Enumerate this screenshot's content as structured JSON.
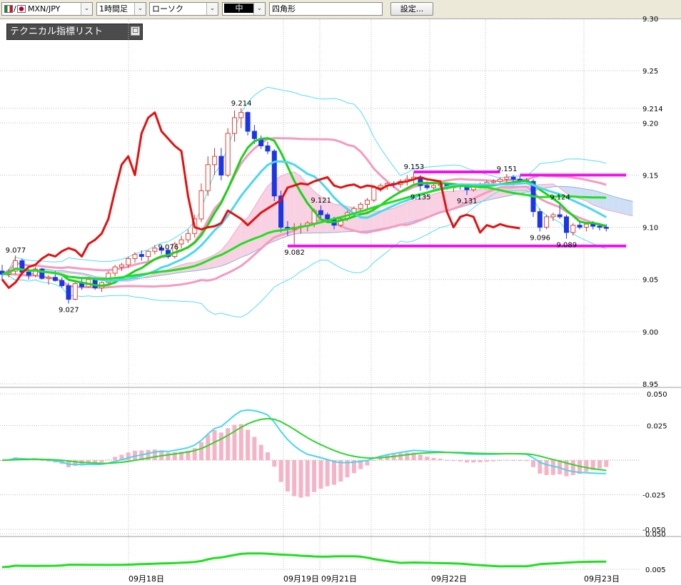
{
  "toolbar": {
    "pair": "MXN/JPY",
    "timeframe": "1時間足",
    "chart_style": "ローソク",
    "line_label": "中",
    "drawing_tool": "四角形",
    "settings_button": "設定..."
  },
  "indicator_panel": {
    "title": "テクニカル指標リスト",
    "button": "□"
  },
  "chart_data": [
    {
      "type": "candlestick",
      "ylim": [
        8.95,
        9.3
      ],
      "yticks": [
        "9.30",
        "9.25",
        "9.214",
        "9.20",
        "9.15",
        "9.10",
        "9.05",
        "9.00",
        "8.95"
      ],
      "xticks": [
        "09月18日",
        "09月19日",
        "09月21日",
        "09月22日",
        "09月23日"
      ],
      "candles": [
        [
          9.058,
          9.064,
          9.05,
          9.055
        ],
        [
          9.055,
          9.06,
          9.052,
          9.058
        ],
        [
          9.058,
          9.073,
          9.055,
          9.068
        ],
        [
          9.068,
          9.07,
          9.056,
          9.057
        ],
        [
          9.057,
          9.06,
          9.05,
          9.054
        ],
        [
          9.054,
          9.062,
          9.052,
          9.06
        ],
        [
          9.06,
          9.061,
          9.05,
          9.051
        ],
        [
          9.051,
          9.054,
          9.045,
          9.052
        ],
        [
          9.052,
          9.058,
          9.048,
          9.049
        ],
        [
          9.049,
          9.052,
          9.042,
          9.044
        ],
        [
          9.044,
          9.047,
          9.027,
          9.031
        ],
        [
          9.031,
          9.048,
          9.03,
          9.046
        ],
        [
          9.046,
          9.052,
          9.04,
          9.043
        ],
        [
          9.043,
          9.051,
          9.042,
          9.05
        ],
        [
          9.05,
          9.052,
          9.04,
          9.042
        ],
        [
          9.042,
          9.048,
          9.038,
          9.047
        ],
        [
          9.047,
          9.058,
          9.045,
          9.056
        ],
        [
          9.056,
          9.064,
          9.053,
          9.062
        ],
        [
          9.062,
          9.066,
          9.058,
          9.064
        ],
        [
          9.064,
          9.072,
          9.061,
          9.07
        ],
        [
          9.07,
          9.076,
          9.066,
          9.074
        ],
        [
          9.074,
          9.078,
          9.068,
          9.072
        ],
        [
          9.072,
          9.078,
          9.068,
          9.077
        ],
        [
          9.077,
          9.083,
          9.074,
          9.08
        ],
        [
          9.08,
          9.082,
          9.074,
          9.078
        ],
        [
          9.078,
          9.08,
          9.07,
          9.072
        ],
        [
          9.072,
          9.086,
          9.07,
          9.084
        ],
        [
          9.084,
          9.092,
          9.08,
          9.088
        ],
        [
          9.088,
          9.098,
          9.085,
          9.094
        ],
        [
          9.094,
          9.112,
          9.09,
          9.108
        ],
        [
          9.108,
          9.142,
          9.105,
          9.135
        ],
        [
          9.135,
          9.168,
          9.13,
          9.16
        ],
        [
          9.16,
          9.176,
          9.15,
          9.168
        ],
        [
          9.168,
          9.176,
          9.145,
          9.15
        ],
        [
          9.15,
          9.195,
          9.148,
          9.19
        ],
        [
          9.19,
          9.212,
          9.182,
          9.205
        ],
        [
          9.205,
          9.214,
          9.195,
          9.21
        ],
        [
          9.21,
          9.211,
          9.188,
          9.192
        ],
        [
          9.192,
          9.198,
          9.18,
          9.185
        ],
        [
          9.185,
          9.188,
          9.175,
          9.178
        ],
        [
          9.178,
          9.182,
          9.17,
          9.173
        ],
        [
          9.173,
          9.175,
          9.125,
          9.13
        ],
        [
          9.13,
          9.135,
          9.095,
          9.1
        ],
        [
          9.1,
          9.106,
          9.092,
          9.098
        ],
        [
          9.098,
          9.104,
          9.082,
          9.1
        ],
        [
          9.1,
          9.104,
          9.094,
          9.101
        ],
        [
          9.101,
          9.106,
          9.096,
          9.104
        ],
        [
          9.104,
          9.118,
          9.1,
          9.116
        ],
        [
          9.116,
          9.121,
          9.108,
          9.112
        ],
        [
          9.112,
          9.114,
          9.104,
          9.108
        ],
        [
          9.108,
          9.11,
          9.098,
          9.102
        ],
        [
          9.102,
          9.11,
          9.1,
          9.108
        ],
        [
          9.108,
          9.116,
          9.106,
          9.114
        ],
        [
          9.114,
          9.12,
          9.11,
          9.118
        ],
        [
          9.118,
          9.124,
          9.114,
          9.122
        ],
        [
          9.122,
          9.128,
          9.118,
          9.126
        ],
        [
          9.126,
          9.14,
          9.124,
          9.138
        ],
        [
          9.138,
          9.142,
          9.134,
          9.14
        ],
        [
          9.14,
          9.143,
          9.136,
          9.142
        ],
        [
          9.142,
          9.144,
          9.138,
          9.141
        ],
        [
          9.141,
          9.146,
          9.138,
          9.144
        ],
        [
          9.144,
          9.15,
          9.14,
          9.146
        ],
        [
          9.146,
          9.153,
          9.142,
          9.148
        ],
        [
          9.148,
          9.15,
          9.135,
          9.14
        ],
        [
          9.14,
          9.144,
          9.136,
          9.138
        ],
        [
          9.138,
          9.142,
          9.135,
          9.14
        ],
        [
          9.14,
          9.143,
          9.136,
          9.141
        ],
        [
          9.141,
          9.142,
          9.136,
          9.138
        ],
        [
          9.138,
          9.142,
          9.134,
          9.14
        ],
        [
          9.14,
          9.142,
          9.136,
          9.139
        ],
        [
          9.139,
          9.141,
          9.131,
          9.136
        ],
        [
          9.136,
          9.141,
          9.134,
          9.14
        ],
        [
          9.14,
          9.143,
          9.137,
          9.141
        ],
        [
          9.141,
          9.145,
          9.138,
          9.143
        ],
        [
          9.143,
          9.146,
          9.14,
          9.144
        ],
        [
          9.144,
          9.148,
          9.141,
          9.146
        ],
        [
          9.146,
          9.151,
          9.142,
          9.148
        ],
        [
          9.148,
          9.15,
          9.14,
          9.146
        ],
        [
          9.146,
          9.149,
          9.141,
          9.145
        ],
        [
          9.145,
          9.147,
          9.142,
          9.144
        ],
        [
          9.144,
          9.146,
          9.11,
          9.115
        ],
        [
          9.115,
          9.118,
          9.096,
          9.1
        ],
        [
          9.1,
          9.112,
          9.098,
          9.11
        ],
        [
          9.11,
          9.114,
          9.106,
          9.112
        ],
        [
          9.112,
          9.124,
          9.108,
          9.11
        ],
        [
          9.11,
          9.112,
          9.089,
          9.095
        ],
        [
          9.095,
          9.104,
          9.092,
          9.102
        ],
        [
          9.102,
          9.106,
          9.098,
          9.1
        ],
        [
          9.1,
          9.104,
          9.096,
          9.103
        ],
        [
          9.103,
          9.106,
          9.098,
          9.101
        ],
        [
          9.101,
          9.104,
          9.097,
          9.1
        ],
        [
          9.1,
          9.103,
          9.096,
          9.099
        ]
      ],
      "price_labels": [
        {
          "text": "9.077",
          "i": 2,
          "v": 9.073
        },
        {
          "text": "9.027",
          "i": 10,
          "v": 9.027
        },
        {
          "text": "9.076",
          "i": 25,
          "v": 9.076
        },
        {
          "text": "9.214",
          "i": 36,
          "v": 9.214
        },
        {
          "text": "9.082",
          "i": 44,
          "v": 9.082
        },
        {
          "text": "9.121",
          "i": 48,
          "v": 9.121
        },
        {
          "text": "9.153",
          "i": 62,
          "v": 9.153
        },
        {
          "text": "9.135",
          "i": 63,
          "v": 9.135
        },
        {
          "text": "9.131",
          "i": 70,
          "v": 9.131
        },
        {
          "text": "9.151",
          "i": 76,
          "v": 9.151
        },
        {
          "text": "9.096",
          "i": 81,
          "v": 9.096
        },
        {
          "text": "9.124",
          "i": 84,
          "v": 9.124
        },
        {
          "text": "9.089",
          "i": 85,
          "v": 9.089
        }
      ],
      "hlines": [
        {
          "v": 9.153,
          "i0": 62,
          "i1": 75
        },
        {
          "v": 9.15,
          "i0": 78,
          "i1": 94
        },
        {
          "v": 9.082,
          "i0": 43,
          "i1": 94
        }
      ],
      "indicators": [
        "bollinger",
        "moving_average",
        "ichimoku_cloud",
        "lagging_line"
      ]
    },
    {
      "type": "macd",
      "ylim": [
        -0.05,
        0.05
      ],
      "yticks": [
        "0.050",
        "0.025",
        "-0.025",
        "-0.050"
      ]
    },
    {
      "type": "line",
      "yticks": [
        "0.050",
        "0.005"
      ]
    }
  ]
}
